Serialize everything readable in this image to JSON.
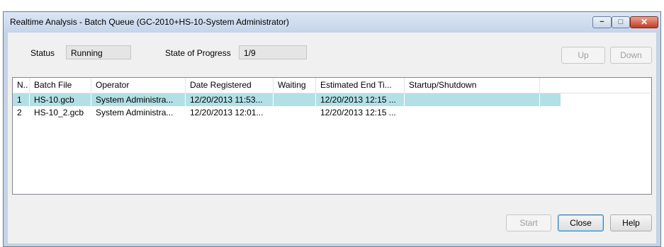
{
  "window": {
    "title": "Realtime Analysis - Batch Queue (GC-2010+HS-10-System Administrator)",
    "controls": {
      "minimize": "−",
      "maximize": "□",
      "close": "✕"
    }
  },
  "status": {
    "label": "Status",
    "value": "Running",
    "progress_label": "State of Progress",
    "progress_value": "1/9"
  },
  "buttons": {
    "up": "Up",
    "down": "Down",
    "start": "Start",
    "close": "Close",
    "help": "Help"
  },
  "table": {
    "columns": [
      "N..",
      "Batch File",
      "Operator",
      "Date Registered",
      "Waiting",
      "Estimated End Ti...",
      "Startup/Shutdown"
    ],
    "rows": [
      [
        "1",
        "HS-10.gcb",
        "System Administra...",
        "12/20/2013 11:53...",
        "",
        "12/20/2013 12:15 ...",
        ""
      ],
      [
        "2",
        "HS-10_2.gcb",
        "System Administra...",
        "12/20/2013 12:01...",
        "",
        "12/20/2013 12:15 ...",
        ""
      ]
    ],
    "selected_row": 0
  },
  "colors": {
    "selection": "#b2e0e6",
    "close_button": "#c23a22"
  },
  "icons": {
    "minimize": "minimize-icon",
    "maximize": "maximize-icon",
    "close": "close-icon"
  }
}
